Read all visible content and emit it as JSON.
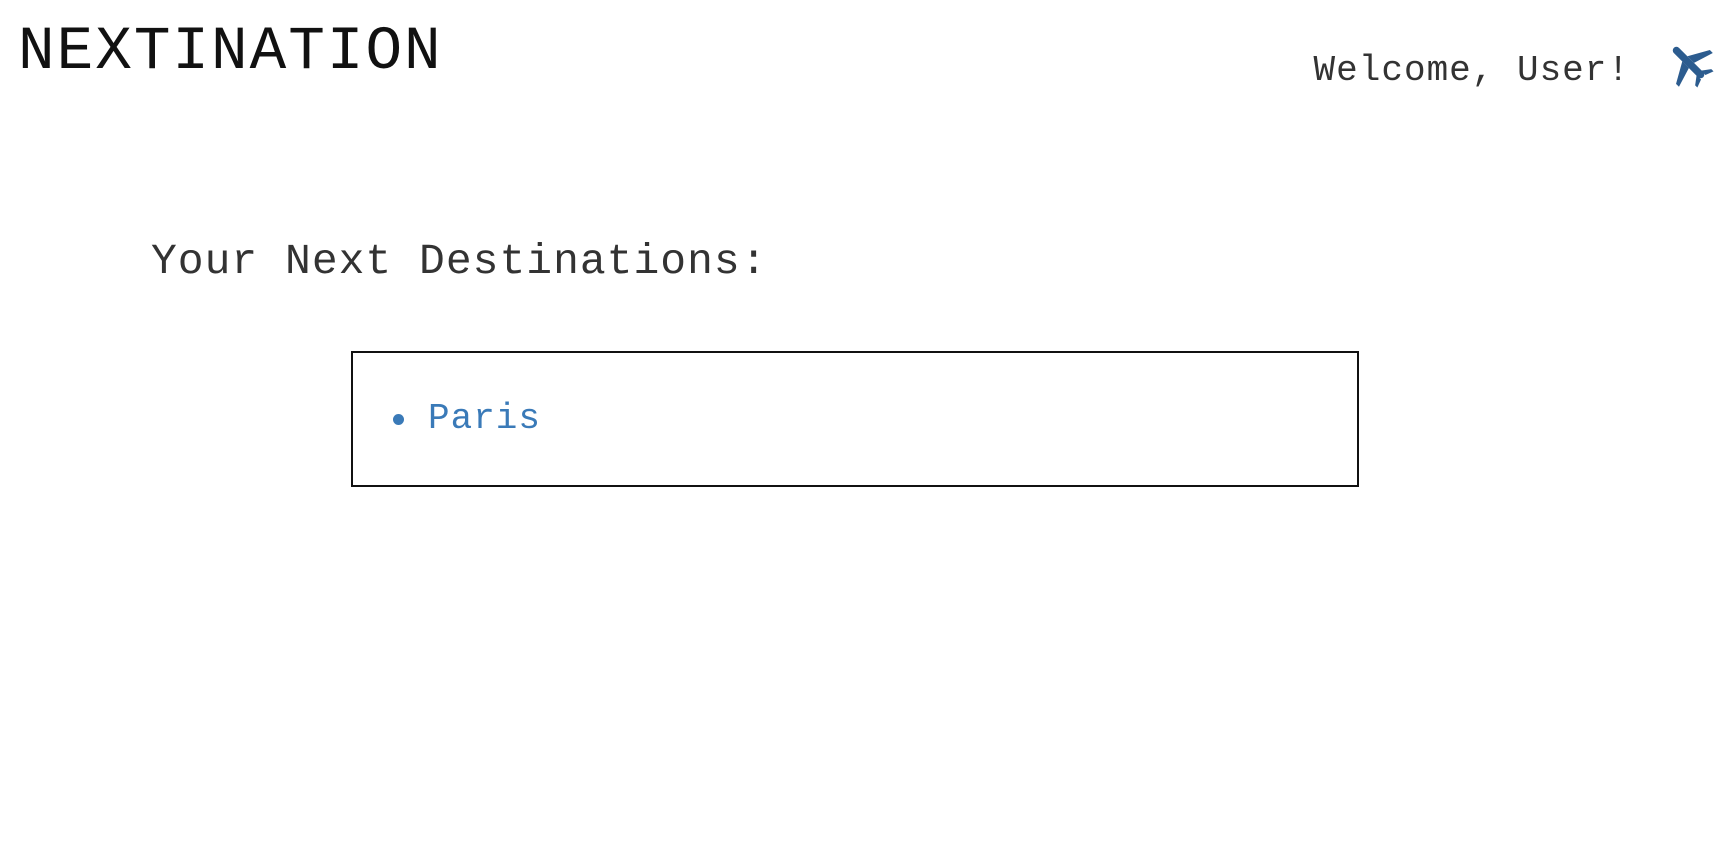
{
  "header": {
    "brand": "NEXTINATION",
    "welcome_text": "Welcome, User!",
    "user_icon": "plane-icon"
  },
  "main": {
    "section_title": "Your Next Destinations:",
    "destinations": [
      {
        "label": "Paris"
      }
    ]
  },
  "colors": {
    "accent": "#3a7ab8",
    "icon": "#2c5c8f",
    "text": "#333333",
    "brand": "#111111"
  }
}
